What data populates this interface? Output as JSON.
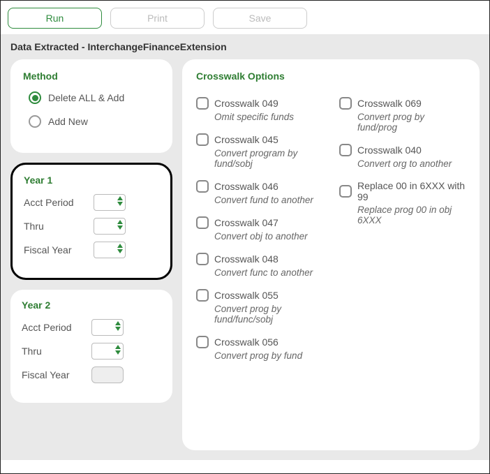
{
  "toolbar": {
    "run": "Run",
    "print": "Print",
    "save": "Save"
  },
  "page_title": "Data Extracted - InterchangeFinanceExtension",
  "method": {
    "title": "Method",
    "opt_delete": "Delete ALL & Add",
    "opt_add": "Add New"
  },
  "year1": {
    "title": "Year 1",
    "acct_period": "Acct Period",
    "thru": "Thru",
    "fiscal_year": "Fiscal Year"
  },
  "year2": {
    "title": "Year 2",
    "acct_period": "Acct Period",
    "thru": "Thru",
    "fiscal_year": "Fiscal Year"
  },
  "crosswalk": {
    "title": "Crosswalk Options",
    "left": [
      {
        "label": "Crosswalk 049",
        "desc": "Omit specific funds"
      },
      {
        "label": "Crosswalk 045",
        "desc": "Convert program by fund/sobj"
      },
      {
        "label": "Crosswalk 046",
        "desc": "Convert fund to another"
      },
      {
        "label": "Crosswalk 047",
        "desc": "Convert obj to another"
      },
      {
        "label": "Crosswalk 048",
        "desc": "Convert func to another"
      },
      {
        "label": "Crosswalk 055",
        "desc": "Convert prog by fund/func/sobj"
      },
      {
        "label": "Crosswalk 056",
        "desc": "Convert prog by fund"
      }
    ],
    "right": [
      {
        "label": "Crosswalk 069",
        "desc": "Convert prog by fund/prog"
      },
      {
        "label": "Crosswalk 040",
        "desc": "Convert org to another"
      },
      {
        "label": "Replace 00 in 6XXX with 99",
        "desc": "Replace prog 00 in obj 6XXX"
      }
    ]
  }
}
